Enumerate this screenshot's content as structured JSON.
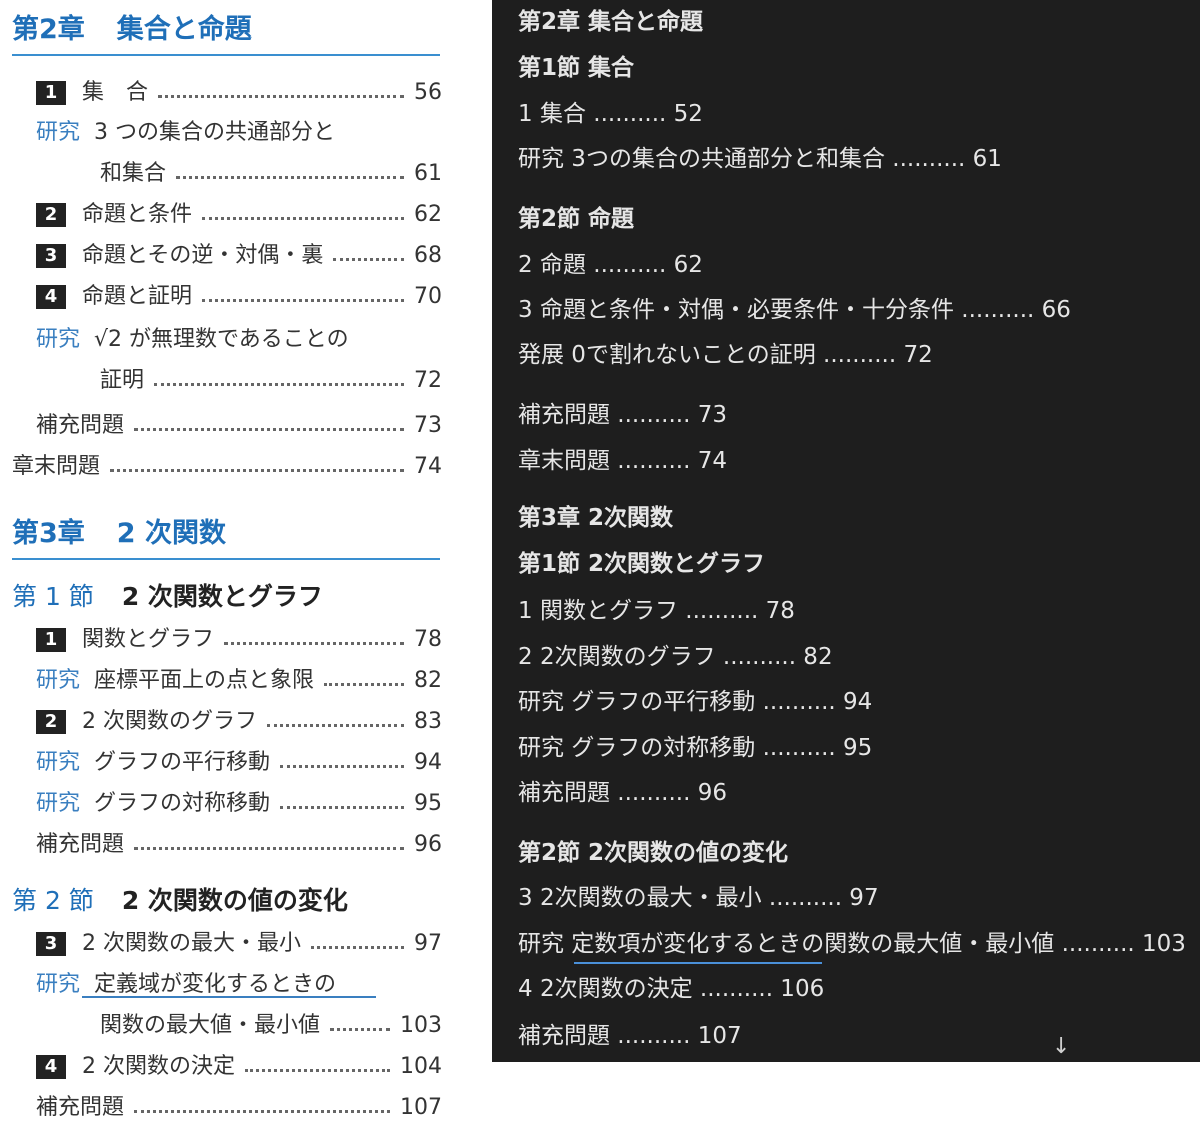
{
  "left": {
    "ch2": {
      "num": "第2章",
      "title": "集合と命題"
    },
    "ch2_items": [
      {
        "box": "1",
        "label": "集　合",
        "page": "56"
      },
      {
        "kenkyu": "研究",
        "label": "3 つの集合の共通部分と"
      },
      {
        "label": "和集合",
        "page": "61"
      },
      {
        "box": "2",
        "label": "命題と条件",
        "page": "62"
      },
      {
        "box": "3",
        "label": "命題とその逆・対偶・裏",
        "page": "68"
      },
      {
        "box": "4",
        "label": "命題と証明",
        "page": "70"
      },
      {
        "kenkyu": "研究",
        "label": "√2 が無理数であることの"
      },
      {
        "label": "証明",
        "page": "72"
      },
      {
        "label": "補充問題",
        "page": "73"
      },
      {
        "label": "章末問題",
        "page": "74"
      }
    ],
    "ch3": {
      "num": "第3章",
      "title": "2 次関数"
    },
    "sec1": {
      "num": "第 1 節",
      "title": "2 次関数とグラフ"
    },
    "sec1_items": [
      {
        "box": "1",
        "label": "関数とグラフ",
        "page": "78"
      },
      {
        "kenkyu": "研究",
        "label": "座標平面上の点と象限",
        "page": "82"
      },
      {
        "box": "2",
        "label": "2 次関数のグラフ",
        "page": "83"
      },
      {
        "kenkyu": "研究",
        "label": "グラフの平行移動",
        "page": "94"
      },
      {
        "kenkyu": "研究",
        "label": "グラフの対称移動",
        "page": "95"
      },
      {
        "label": "補充問題",
        "page": "96"
      }
    ],
    "sec2": {
      "num": "第 2 節",
      "title": "2 次関数の値の変化"
    },
    "sec2_items": [
      {
        "box": "3",
        "label": "2 次関数の最大・最小",
        "page": "97"
      },
      {
        "kenkyu": "研究",
        "label": "定義域が変化するときの"
      },
      {
        "label": "関数の最大値・最小値",
        "page": "103"
      },
      {
        "box": "4",
        "label": "2 次関数の決定",
        "page": "104"
      },
      {
        "label": "補充問題",
        "page": "107"
      }
    ]
  },
  "right": {
    "lines": [
      {
        "text": "第2章 集合と命題",
        "head": true
      },
      {
        "text": "第1節 集合",
        "head": true
      },
      {
        "text": "1 集合 .......... 52"
      },
      {
        "text": "研究 3つの集合の共通部分と和集合 .......... 61"
      },
      {
        "text": "第2節 命題",
        "head": true
      },
      {
        "text": "2 命題 .......... 62"
      },
      {
        "text": "3 命題と条件・対偶・必要条件・十分条件 .......... 66"
      },
      {
        "text": "発展 0で割れないことの証明 .......... 72"
      },
      {
        "text": "補充問題 .......... 73"
      },
      {
        "text": "章末問題 .......... 74"
      },
      {
        "text": "第3章 2次関数",
        "head": true
      },
      {
        "text": "第1節 2次関数とグラフ",
        "head": true
      },
      {
        "text": "1 関数とグラフ .......... 78"
      },
      {
        "text": "2 2次関数のグラフ .......... 82"
      },
      {
        "text": "研究 グラフの平行移動 .......... 94"
      },
      {
        "text": "研究 グラフの対称移動 .......... 95"
      },
      {
        "text": "補充問題 .......... 96"
      },
      {
        "text": "第2節 2次関数の値の変化",
        "head": true
      },
      {
        "text": "3 2次関数の最大・最小 .......... 97"
      },
      {
        "text": "研究 定数項が変化するときの関数の最大値・最小値 .......... 103"
      },
      {
        "text": "4 2次関数の決定 .......... 106"
      },
      {
        "text": "補充問題 .......... 107"
      }
    ],
    "scroll_icon": "down-arrow-icon",
    "arrow_glyph": "↓"
  },
  "colors": {
    "accent_blue": "#1f6fb8",
    "dark_bg": "#1e1e1e",
    "underline_blue": "#4a90d9"
  }
}
